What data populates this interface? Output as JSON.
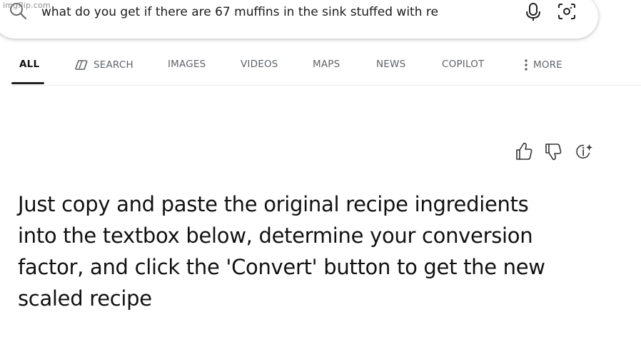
{
  "watermark": "imgflip.com",
  "search": {
    "query": "what do you get if there are 67 muffins in the sink stuffed with re"
  },
  "tabs": [
    {
      "label": "ALL",
      "active": true
    },
    {
      "label": "SEARCH",
      "icon": "copilot-search-icon"
    },
    {
      "label": "IMAGES"
    },
    {
      "label": "VIDEOS"
    },
    {
      "label": "MAPS"
    },
    {
      "label": "NEWS"
    },
    {
      "label": "COPILOT"
    },
    {
      "label": "MORE",
      "icon": "more-vertical-icon"
    }
  ],
  "feedback": {
    "icons": [
      "thumbs-up-icon",
      "thumbs-down-icon",
      "info-sparkle-icon"
    ]
  },
  "answer": {
    "text": "Just copy and paste the original recipe ingredients into the textbox below, determine your conversion factor, and click the 'Convert' button to get the new scaled recipe"
  }
}
